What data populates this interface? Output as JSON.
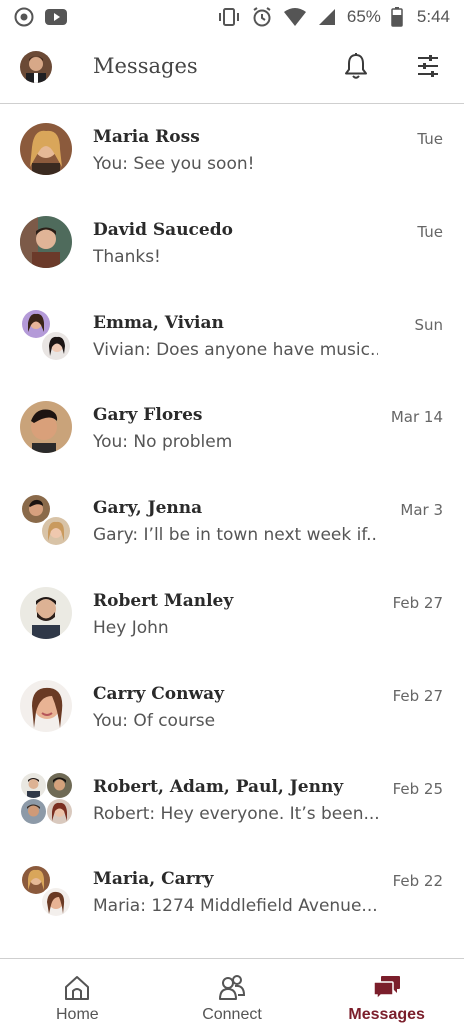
{
  "status_bar": {
    "left_icons": [
      "record-icon",
      "youtube-icon"
    ],
    "right_icons": [
      "vibrate-icon",
      "alarm-icon",
      "wifi-icon",
      "signal-icon"
    ],
    "battery": "65%",
    "time": "5:44"
  },
  "header": {
    "title": "Messages",
    "icons": [
      "profile-avatar",
      "bell-icon",
      "sliders-icon"
    ]
  },
  "conversations": [
    {
      "name": "Maria Ross",
      "preview": "You: See you soon!",
      "date": "Tue"
    },
    {
      "name": "David Saucedo",
      "preview": "Thanks!",
      "date": "Tue"
    },
    {
      "name": "Emma, Vivian",
      "preview": "Vivian: Does anyone have music...",
      "date": "Sun"
    },
    {
      "name": "Gary Flores",
      "preview": "You: No problem",
      "date": "Mar 14"
    },
    {
      "name": "Gary, Jenna",
      "preview": "Gary: I’ll be in town next week if...",
      "date": "Mar 3"
    },
    {
      "name": "Robert Manley",
      "preview": "Hey John",
      "date": "Feb 27"
    },
    {
      "name": "Carry Conway",
      "preview": "You: Of course",
      "date": "Feb 27"
    },
    {
      "name": "Robert, Adam, Paul, Jenny",
      "preview": "Robert: Hey everyone. It’s been...",
      "date": "Feb 25"
    },
    {
      "name": "Maria, Carry",
      "preview": "Maria: 1274 Middlefield Avenue...",
      "date": "Feb 22"
    }
  ],
  "bottom_nav": {
    "items": [
      {
        "label": "Home",
        "icon": "home-icon"
      },
      {
        "label": "Connect",
        "icon": "people-icon"
      },
      {
        "label": "Messages",
        "icon": "chat-icon"
      }
    ],
    "active": "Messages",
    "active_color": "#7b1e2b"
  }
}
